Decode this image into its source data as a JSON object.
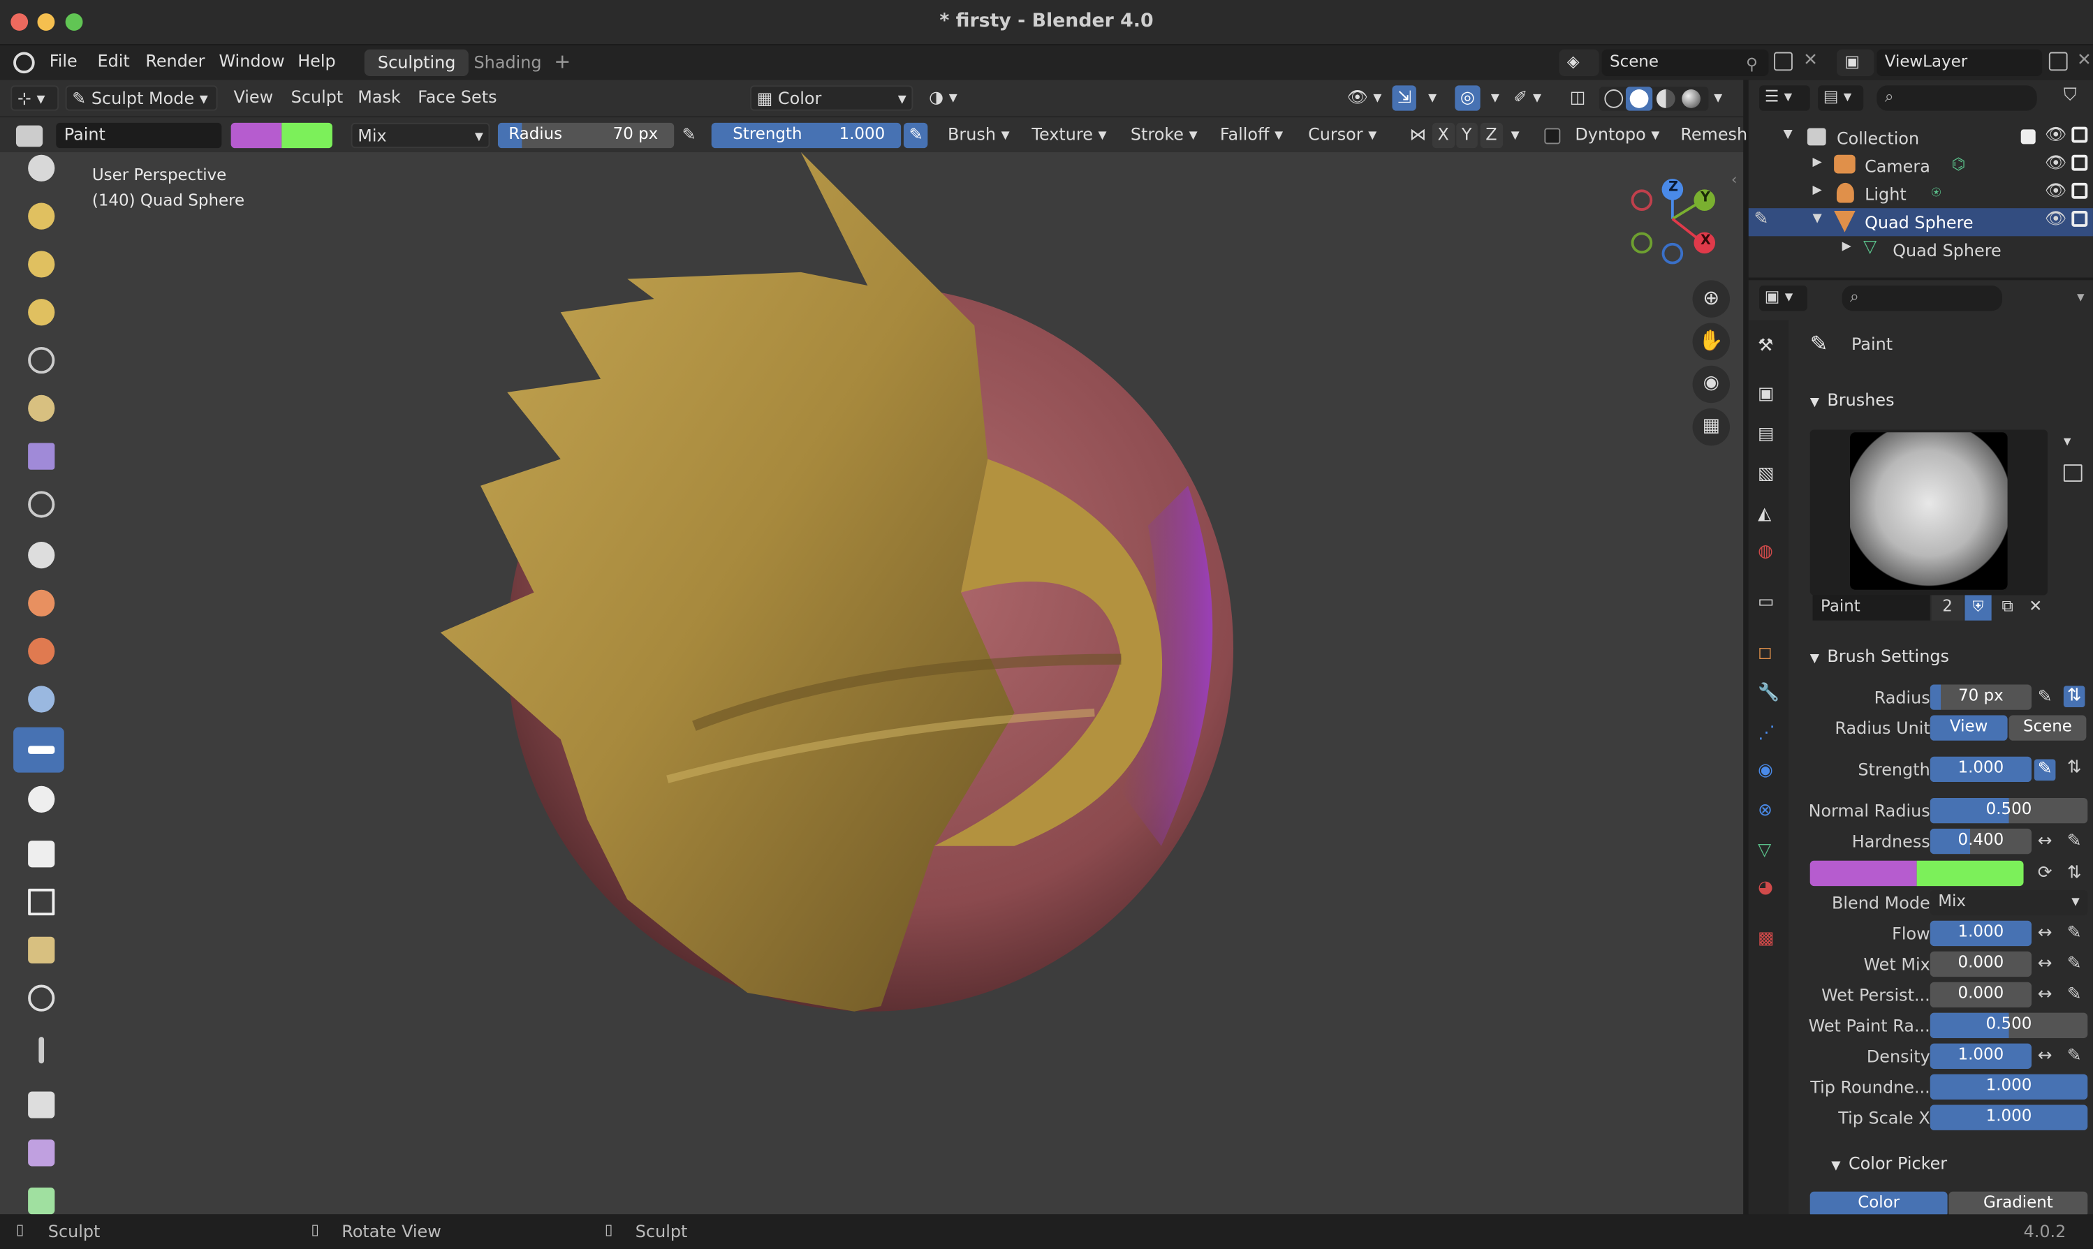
{
  "window": {
    "title": "* firsty - Blender 4.0"
  },
  "menu": {
    "items": [
      "File",
      "Edit",
      "Render",
      "Window",
      "Help"
    ],
    "workspaces": [
      "Sculpting",
      "Shading"
    ],
    "add_tab": "+",
    "scene": "Scene",
    "view_layer": "ViewLayer"
  },
  "header": {
    "mode": "Sculpt Mode",
    "menus": [
      "View",
      "Sculpt",
      "Mask",
      "Face Sets"
    ],
    "color_mode": "Color",
    "brush_name": "Paint",
    "blend": "Mix",
    "radius_label": "Radius",
    "radius_value": "70 px",
    "strength_label": "Strength",
    "strength_value": "1.000",
    "dropdowns": [
      "Brush",
      "Texture",
      "Stroke",
      "Falloff",
      "Cursor"
    ],
    "axes": [
      "X",
      "Y",
      "Z"
    ],
    "dyntopo": "Dyntopo",
    "remesh": "Remesh",
    "primary_color": "#b65ccf",
    "secondary_color": "#7cf05a"
  },
  "viewport": {
    "perspective": "User Perspective",
    "object": "(140) Quad Sphere",
    "gizmo": {
      "z": "Z",
      "y": "Y",
      "x": "X"
    }
  },
  "outliner": {
    "rows": [
      {
        "label": "Collection"
      },
      {
        "label": "Camera"
      },
      {
        "label": "Light"
      },
      {
        "label": "Quad Sphere"
      },
      {
        "label": "Quad Sphere"
      }
    ]
  },
  "properties": {
    "tool_title": "Paint",
    "brushes_header": "Brushes",
    "brush_name": "Paint",
    "brush_users": "2",
    "brush_settings_header": "Brush Settings",
    "radius": {
      "label": "Radius",
      "value": "70 px"
    },
    "radius_unit": {
      "label": "Radius Unit",
      "view": "View",
      "scene": "Scene"
    },
    "strength": {
      "label": "Strength",
      "value": "1.000"
    },
    "normal_radius": {
      "label": "Normal Radius",
      "value": "0.500",
      "fraction": 0.5
    },
    "hardness": {
      "label": "Hardness",
      "value": "0.400",
      "fraction": 0.4
    },
    "blend_mode": {
      "label": "Blend Mode",
      "value": "Mix"
    },
    "flow": {
      "label": "Flow",
      "value": "1.000"
    },
    "wet_mix": {
      "label": "Wet Mix",
      "value": "0.000"
    },
    "wet_persist": {
      "label": "Wet Persist...",
      "value": "0.000"
    },
    "wet_paint_radius": {
      "label": "Wet Paint Ra...",
      "value": "0.500",
      "fraction": 0.5
    },
    "density": {
      "label": "Density",
      "value": "1.000"
    },
    "tip_roundness": {
      "label": "Tip Roundne...",
      "value": "1.000"
    },
    "tip_scale_x": {
      "label": "Tip Scale X",
      "value": "1.000"
    },
    "color_picker_header": "Color Picker",
    "color_tab": "Color",
    "gradient_tab": "Gradient"
  },
  "status": {
    "left": "Sculpt",
    "middle": "Rotate View",
    "right": "Sculpt",
    "version": "4.0.2"
  }
}
